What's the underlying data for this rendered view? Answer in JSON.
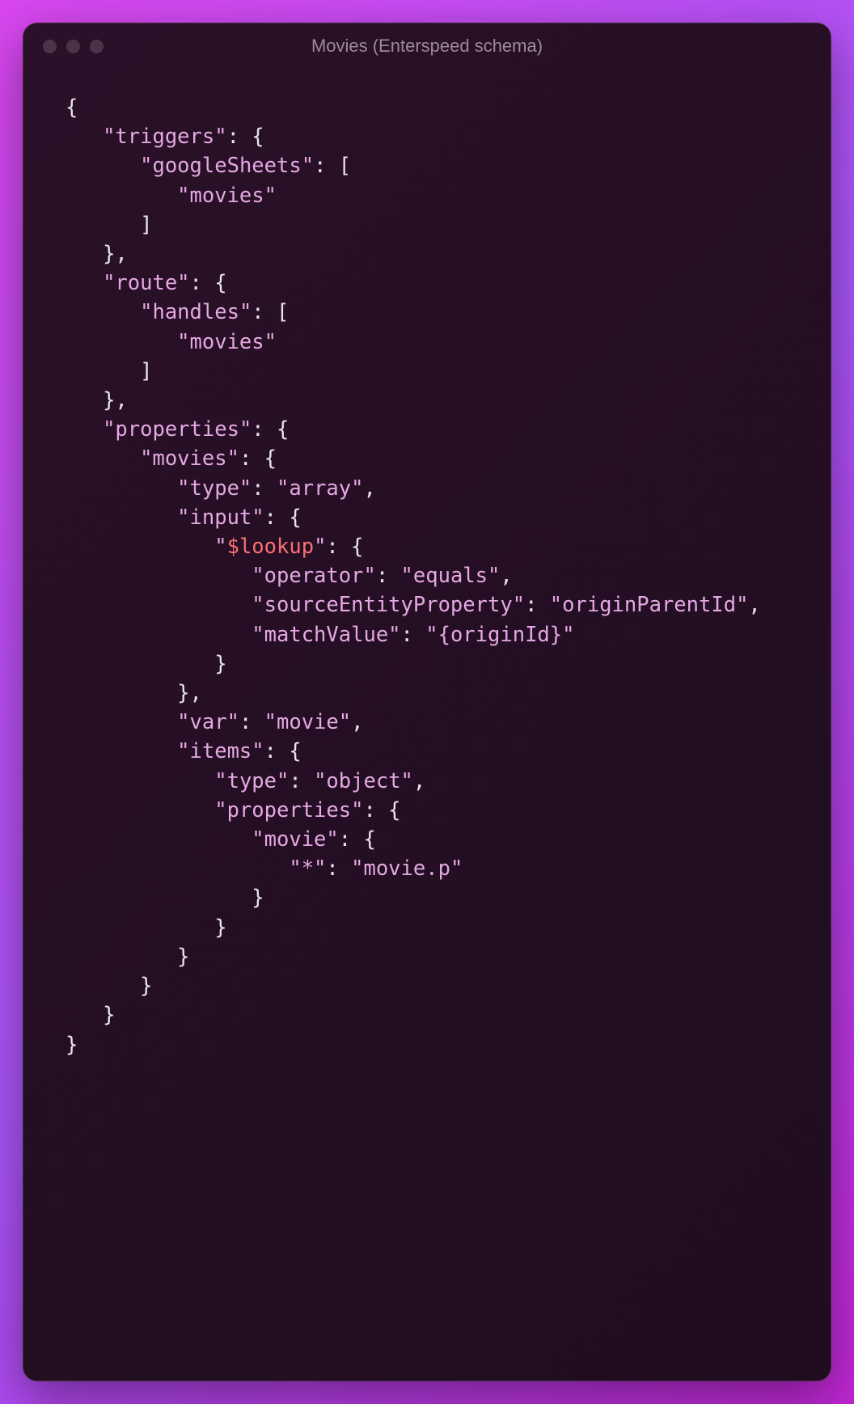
{
  "window": {
    "title": "Movies (Enterspeed schema)"
  },
  "code": {
    "lines": [
      [
        {
          "t": "{",
          "c": "c-brace",
          "i": 0
        }
      ],
      [
        {
          "t": "\"triggers\"",
          "c": "c-pink",
          "i": 1
        },
        {
          "t": ": {",
          "c": "c-brace"
        }
      ],
      [
        {
          "t": "\"googleSheets\"",
          "c": "c-pink",
          "i": 2
        },
        {
          "t": ": [",
          "c": "c-brace"
        }
      ],
      [
        {
          "t": "\"movies\"",
          "c": "c-pink",
          "i": 3
        }
      ],
      [
        {
          "t": "]",
          "c": "c-brace",
          "i": 2
        }
      ],
      [
        {
          "t": "},",
          "c": "c-brace",
          "i": 1
        }
      ],
      [
        {
          "t": "\"route\"",
          "c": "c-pink",
          "i": 1
        },
        {
          "t": ": {",
          "c": "c-brace"
        }
      ],
      [
        {
          "t": "\"handles\"",
          "c": "c-pink",
          "i": 2
        },
        {
          "t": ": [",
          "c": "c-brace"
        }
      ],
      [
        {
          "t": "\"movies\"",
          "c": "c-pink",
          "i": 3
        }
      ],
      [
        {
          "t": "]",
          "c": "c-brace",
          "i": 2
        }
      ],
      [
        {
          "t": "},",
          "c": "c-brace",
          "i": 1
        }
      ],
      [
        {
          "t": "\"properties\"",
          "c": "c-pink",
          "i": 1
        },
        {
          "t": ": {",
          "c": "c-brace"
        }
      ],
      [
        {
          "t": "\"movies\"",
          "c": "c-pink",
          "i": 2
        },
        {
          "t": ": {",
          "c": "c-brace"
        }
      ],
      [
        {
          "t": "\"type\"",
          "c": "c-pink",
          "i": 3
        },
        {
          "t": ": ",
          "c": "c-brace"
        },
        {
          "t": "\"array\"",
          "c": "c-pink"
        },
        {
          "t": ",",
          "c": "c-brace"
        }
      ],
      [
        {
          "t": "\"input\"",
          "c": "c-pink",
          "i": 3
        },
        {
          "t": ": {",
          "c": "c-brace"
        }
      ],
      [
        {
          "t": "\"",
          "c": "c-pink",
          "i": 4
        },
        {
          "t": "$lookup",
          "c": "c-salmon"
        },
        {
          "t": "\"",
          "c": "c-pink"
        },
        {
          "t": ": {",
          "c": "c-brace"
        }
      ],
      [
        {
          "t": "\"operator\"",
          "c": "c-pink",
          "i": 5
        },
        {
          "t": ": ",
          "c": "c-brace"
        },
        {
          "t": "\"equals\"",
          "c": "c-pink"
        },
        {
          "t": ",",
          "c": "c-brace"
        }
      ],
      [
        {
          "t": "\"sourceEntityProperty\"",
          "c": "c-pink",
          "i": 5
        },
        {
          "t": ": ",
          "c": "c-brace"
        },
        {
          "t": "\"originParentId\"",
          "c": "c-pink"
        },
        {
          "t": ",",
          "c": "c-brace"
        }
      ],
      [
        {
          "t": "\"matchValue\"",
          "c": "c-pink",
          "i": 5
        },
        {
          "t": ": ",
          "c": "c-brace"
        },
        {
          "t": "\"{originId}\"",
          "c": "c-pink"
        }
      ],
      [
        {
          "t": "}",
          "c": "c-brace",
          "i": 4
        }
      ],
      [
        {
          "t": "},",
          "c": "c-brace",
          "i": 3
        }
      ],
      [
        {
          "t": "\"var\"",
          "c": "c-pink",
          "i": 3
        },
        {
          "t": ": ",
          "c": "c-brace"
        },
        {
          "t": "\"movie\"",
          "c": "c-pink"
        },
        {
          "t": ",",
          "c": "c-brace"
        }
      ],
      [
        {
          "t": "\"items\"",
          "c": "c-pink",
          "i": 3
        },
        {
          "t": ": {",
          "c": "c-brace"
        }
      ],
      [
        {
          "t": "\"type\"",
          "c": "c-pink",
          "i": 4
        },
        {
          "t": ": ",
          "c": "c-brace"
        },
        {
          "t": "\"object\"",
          "c": "c-pink"
        },
        {
          "t": ",",
          "c": "c-brace"
        }
      ],
      [
        {
          "t": "\"properties\"",
          "c": "c-pink",
          "i": 4
        },
        {
          "t": ": {",
          "c": "c-brace"
        }
      ],
      [
        {
          "t": "\"movie\"",
          "c": "c-pink",
          "i": 5
        },
        {
          "t": ": {",
          "c": "c-brace"
        }
      ],
      [
        {
          "t": "\"*\"",
          "c": "c-pink",
          "i": 6
        },
        {
          "t": ": ",
          "c": "c-brace"
        },
        {
          "t": "\"movie.p\"",
          "c": "c-pink"
        }
      ],
      [
        {
          "t": "}",
          "c": "c-brace",
          "i": 5
        }
      ],
      [
        {
          "t": "}",
          "c": "c-brace",
          "i": 4
        }
      ],
      [
        {
          "t": "}",
          "c": "c-brace",
          "i": 3
        }
      ],
      [
        {
          "t": "}",
          "c": "c-brace",
          "i": 2
        }
      ],
      [
        {
          "t": "}",
          "c": "c-brace",
          "i": 1
        }
      ],
      [
        {
          "t": "}",
          "c": "c-brace",
          "i": 0
        }
      ]
    ]
  }
}
